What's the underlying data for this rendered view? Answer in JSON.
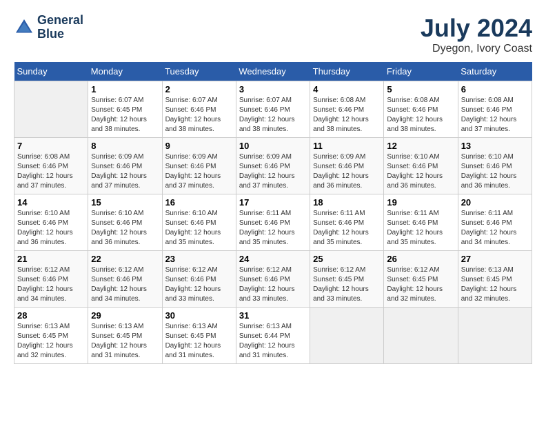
{
  "header": {
    "logo_line1": "General",
    "logo_line2": "Blue",
    "month_year": "July 2024",
    "location": "Dyegon, Ivory Coast"
  },
  "calendar": {
    "weekdays": [
      "Sunday",
      "Monday",
      "Tuesday",
      "Wednesday",
      "Thursday",
      "Friday",
      "Saturday"
    ],
    "weeks": [
      [
        {
          "day": "",
          "empty": true
        },
        {
          "day": "1",
          "sunrise": "Sunrise: 6:07 AM",
          "sunset": "Sunset: 6:45 PM",
          "daylight": "Daylight: 12 hours and 38 minutes."
        },
        {
          "day": "2",
          "sunrise": "Sunrise: 6:07 AM",
          "sunset": "Sunset: 6:46 PM",
          "daylight": "Daylight: 12 hours and 38 minutes."
        },
        {
          "day": "3",
          "sunrise": "Sunrise: 6:07 AM",
          "sunset": "Sunset: 6:46 PM",
          "daylight": "Daylight: 12 hours and 38 minutes."
        },
        {
          "day": "4",
          "sunrise": "Sunrise: 6:08 AM",
          "sunset": "Sunset: 6:46 PM",
          "daylight": "Daylight: 12 hours and 38 minutes."
        },
        {
          "day": "5",
          "sunrise": "Sunrise: 6:08 AM",
          "sunset": "Sunset: 6:46 PM",
          "daylight": "Daylight: 12 hours and 38 minutes."
        },
        {
          "day": "6",
          "sunrise": "Sunrise: 6:08 AM",
          "sunset": "Sunset: 6:46 PM",
          "daylight": "Daylight: 12 hours and 37 minutes."
        }
      ],
      [
        {
          "day": "7",
          "sunrise": "Sunrise: 6:08 AM",
          "sunset": "Sunset: 6:46 PM",
          "daylight": "Daylight: 12 hours and 37 minutes."
        },
        {
          "day": "8",
          "sunrise": "Sunrise: 6:09 AM",
          "sunset": "Sunset: 6:46 PM",
          "daylight": "Daylight: 12 hours and 37 minutes."
        },
        {
          "day": "9",
          "sunrise": "Sunrise: 6:09 AM",
          "sunset": "Sunset: 6:46 PM",
          "daylight": "Daylight: 12 hours and 37 minutes."
        },
        {
          "day": "10",
          "sunrise": "Sunrise: 6:09 AM",
          "sunset": "Sunset: 6:46 PM",
          "daylight": "Daylight: 12 hours and 37 minutes."
        },
        {
          "day": "11",
          "sunrise": "Sunrise: 6:09 AM",
          "sunset": "Sunset: 6:46 PM",
          "daylight": "Daylight: 12 hours and 36 minutes."
        },
        {
          "day": "12",
          "sunrise": "Sunrise: 6:10 AM",
          "sunset": "Sunset: 6:46 PM",
          "daylight": "Daylight: 12 hours and 36 minutes."
        },
        {
          "day": "13",
          "sunrise": "Sunrise: 6:10 AM",
          "sunset": "Sunset: 6:46 PM",
          "daylight": "Daylight: 12 hours and 36 minutes."
        }
      ],
      [
        {
          "day": "14",
          "sunrise": "Sunrise: 6:10 AM",
          "sunset": "Sunset: 6:46 PM",
          "daylight": "Daylight: 12 hours and 36 minutes."
        },
        {
          "day": "15",
          "sunrise": "Sunrise: 6:10 AM",
          "sunset": "Sunset: 6:46 PM",
          "daylight": "Daylight: 12 hours and 36 minutes."
        },
        {
          "day": "16",
          "sunrise": "Sunrise: 6:10 AM",
          "sunset": "Sunset: 6:46 PM",
          "daylight": "Daylight: 12 hours and 35 minutes."
        },
        {
          "day": "17",
          "sunrise": "Sunrise: 6:11 AM",
          "sunset": "Sunset: 6:46 PM",
          "daylight": "Daylight: 12 hours and 35 minutes."
        },
        {
          "day": "18",
          "sunrise": "Sunrise: 6:11 AM",
          "sunset": "Sunset: 6:46 PM",
          "daylight": "Daylight: 12 hours and 35 minutes."
        },
        {
          "day": "19",
          "sunrise": "Sunrise: 6:11 AM",
          "sunset": "Sunset: 6:46 PM",
          "daylight": "Daylight: 12 hours and 35 minutes."
        },
        {
          "day": "20",
          "sunrise": "Sunrise: 6:11 AM",
          "sunset": "Sunset: 6:46 PM",
          "daylight": "Daylight: 12 hours and 34 minutes."
        }
      ],
      [
        {
          "day": "21",
          "sunrise": "Sunrise: 6:12 AM",
          "sunset": "Sunset: 6:46 PM",
          "daylight": "Daylight: 12 hours and 34 minutes."
        },
        {
          "day": "22",
          "sunrise": "Sunrise: 6:12 AM",
          "sunset": "Sunset: 6:46 PM",
          "daylight": "Daylight: 12 hours and 34 minutes."
        },
        {
          "day": "23",
          "sunrise": "Sunrise: 6:12 AM",
          "sunset": "Sunset: 6:46 PM",
          "daylight": "Daylight: 12 hours and 33 minutes."
        },
        {
          "day": "24",
          "sunrise": "Sunrise: 6:12 AM",
          "sunset": "Sunset: 6:46 PM",
          "daylight": "Daylight: 12 hours and 33 minutes."
        },
        {
          "day": "25",
          "sunrise": "Sunrise: 6:12 AM",
          "sunset": "Sunset: 6:45 PM",
          "daylight": "Daylight: 12 hours and 33 minutes."
        },
        {
          "day": "26",
          "sunrise": "Sunrise: 6:12 AM",
          "sunset": "Sunset: 6:45 PM",
          "daylight": "Daylight: 12 hours and 32 minutes."
        },
        {
          "day": "27",
          "sunrise": "Sunrise: 6:13 AM",
          "sunset": "Sunset: 6:45 PM",
          "daylight": "Daylight: 12 hours and 32 minutes."
        }
      ],
      [
        {
          "day": "28",
          "sunrise": "Sunrise: 6:13 AM",
          "sunset": "Sunset: 6:45 PM",
          "daylight": "Daylight: 12 hours and 32 minutes."
        },
        {
          "day": "29",
          "sunrise": "Sunrise: 6:13 AM",
          "sunset": "Sunset: 6:45 PM",
          "daylight": "Daylight: 12 hours and 31 minutes."
        },
        {
          "day": "30",
          "sunrise": "Sunrise: 6:13 AM",
          "sunset": "Sunset: 6:45 PM",
          "daylight": "Daylight: 12 hours and 31 minutes."
        },
        {
          "day": "31",
          "sunrise": "Sunrise: 6:13 AM",
          "sunset": "Sunset: 6:44 PM",
          "daylight": "Daylight: 12 hours and 31 minutes."
        },
        {
          "day": "",
          "empty": true
        },
        {
          "day": "",
          "empty": true
        },
        {
          "day": "",
          "empty": true
        }
      ]
    ]
  }
}
